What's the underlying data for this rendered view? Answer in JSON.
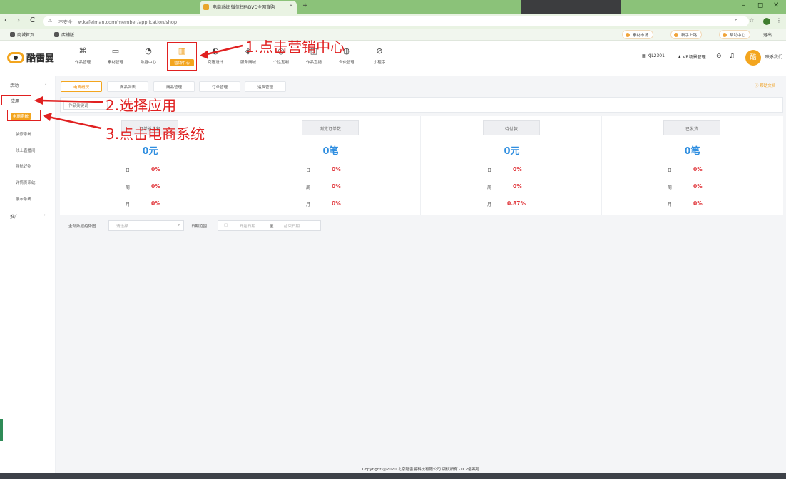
{
  "browser": {
    "tab_title": "电商系统 微信扫码DVD全网直购",
    "tab_close": "×",
    "new_tab": "+",
    "back": "‹",
    "forward": "›",
    "reload": "C",
    "insecure_label": "不安全",
    "url": "w.kafeiman.com/member/application/shop",
    "bookmarks": [
      "商城首页",
      "店铺版"
    ],
    "pills": [
      "素材市场",
      "新手上路",
      "帮助中心"
    ],
    "profile": "退出"
  },
  "header": {
    "logo_text": "酷雷曼",
    "nav": [
      {
        "icon": "⌘",
        "label": "作品管理",
        "name": "works"
      },
      {
        "icon": "▭",
        "label": "素材管理",
        "name": "materials"
      },
      {
        "icon": "◔",
        "label": "数据中心",
        "name": "data"
      },
      {
        "icon": "▥",
        "label": "营销中心",
        "name": "marketing"
      },
      {
        "icon": "◐",
        "label": "克隆设计",
        "name": "clone"
      },
      {
        "icon": "◈",
        "label": "服务商城",
        "name": "service"
      },
      {
        "icon": "◎",
        "label": "个性定制",
        "name": "custom"
      },
      {
        "icon": "◫",
        "label": "作品直播",
        "name": "live"
      },
      {
        "icon": "◍",
        "label": "合伙管理",
        "name": "partner"
      },
      {
        "icon": "⊘",
        "label": "小程序",
        "name": "miniapp"
      }
    ],
    "right": [
      "KJL2301",
      "VR场景管理",
      "联系我们"
    ]
  },
  "sidebar": {
    "group_activity": "活动",
    "app": "应用",
    "ecommerce": "电商系统",
    "items": [
      "装修系统",
      "线上直播间",
      "导航好物",
      "详情页系统",
      "展示系统"
    ],
    "group_other": "推广"
  },
  "subtabs": [
    "电商概况",
    "商品列表",
    "商品管理",
    "订单管理",
    "运费管理"
  ],
  "help_link": "帮助文档",
  "search_placeholder": "作品关键词",
  "stats": [
    {
      "title": "订单总金额",
      "value": "0元",
      "rows": [
        {
          "k": "日",
          "v": "0%"
        },
        {
          "k": "周",
          "v": "0%"
        },
        {
          "k": "月",
          "v": "0%"
        }
      ]
    },
    {
      "title": "浏览订单数",
      "value": "0笔",
      "rows": [
        {
          "k": "日",
          "v": "0%"
        },
        {
          "k": "周",
          "v": "0%"
        },
        {
          "k": "月",
          "v": "0%"
        }
      ]
    },
    {
      "title": "待付款",
      "value": "0元",
      "rows": [
        {
          "k": "日",
          "v": "0%"
        },
        {
          "k": "周",
          "v": "0%"
        },
        {
          "k": "月",
          "v": "0.87%"
        }
      ]
    },
    {
      "title": "已发货",
      "value": "0笔",
      "rows": [
        {
          "k": "日",
          "v": "0%"
        },
        {
          "k": "周",
          "v": "0%"
        },
        {
          "k": "月",
          "v": "0%"
        }
      ]
    }
  ],
  "filters": {
    "select_label": "全部数据趋势图",
    "select_placeholder": "请选择",
    "date_label": "日期范围",
    "start_placeholder": "开始日期",
    "separator": "至",
    "end_placeholder": "结束日期"
  },
  "footer": "Copyright @2020 北京酷雷曼科技有限公司 版权所有 · ICP备案号",
  "annotations": {
    "step1": "1.点击营销中心",
    "step2": "2.选择应用",
    "step3": "3.点击电商系统"
  },
  "colors": {
    "accent": "#f3a51e",
    "annotation": "#e02020",
    "value_blue": "#2f8ee0",
    "pct_red": "#e0353a"
  }
}
